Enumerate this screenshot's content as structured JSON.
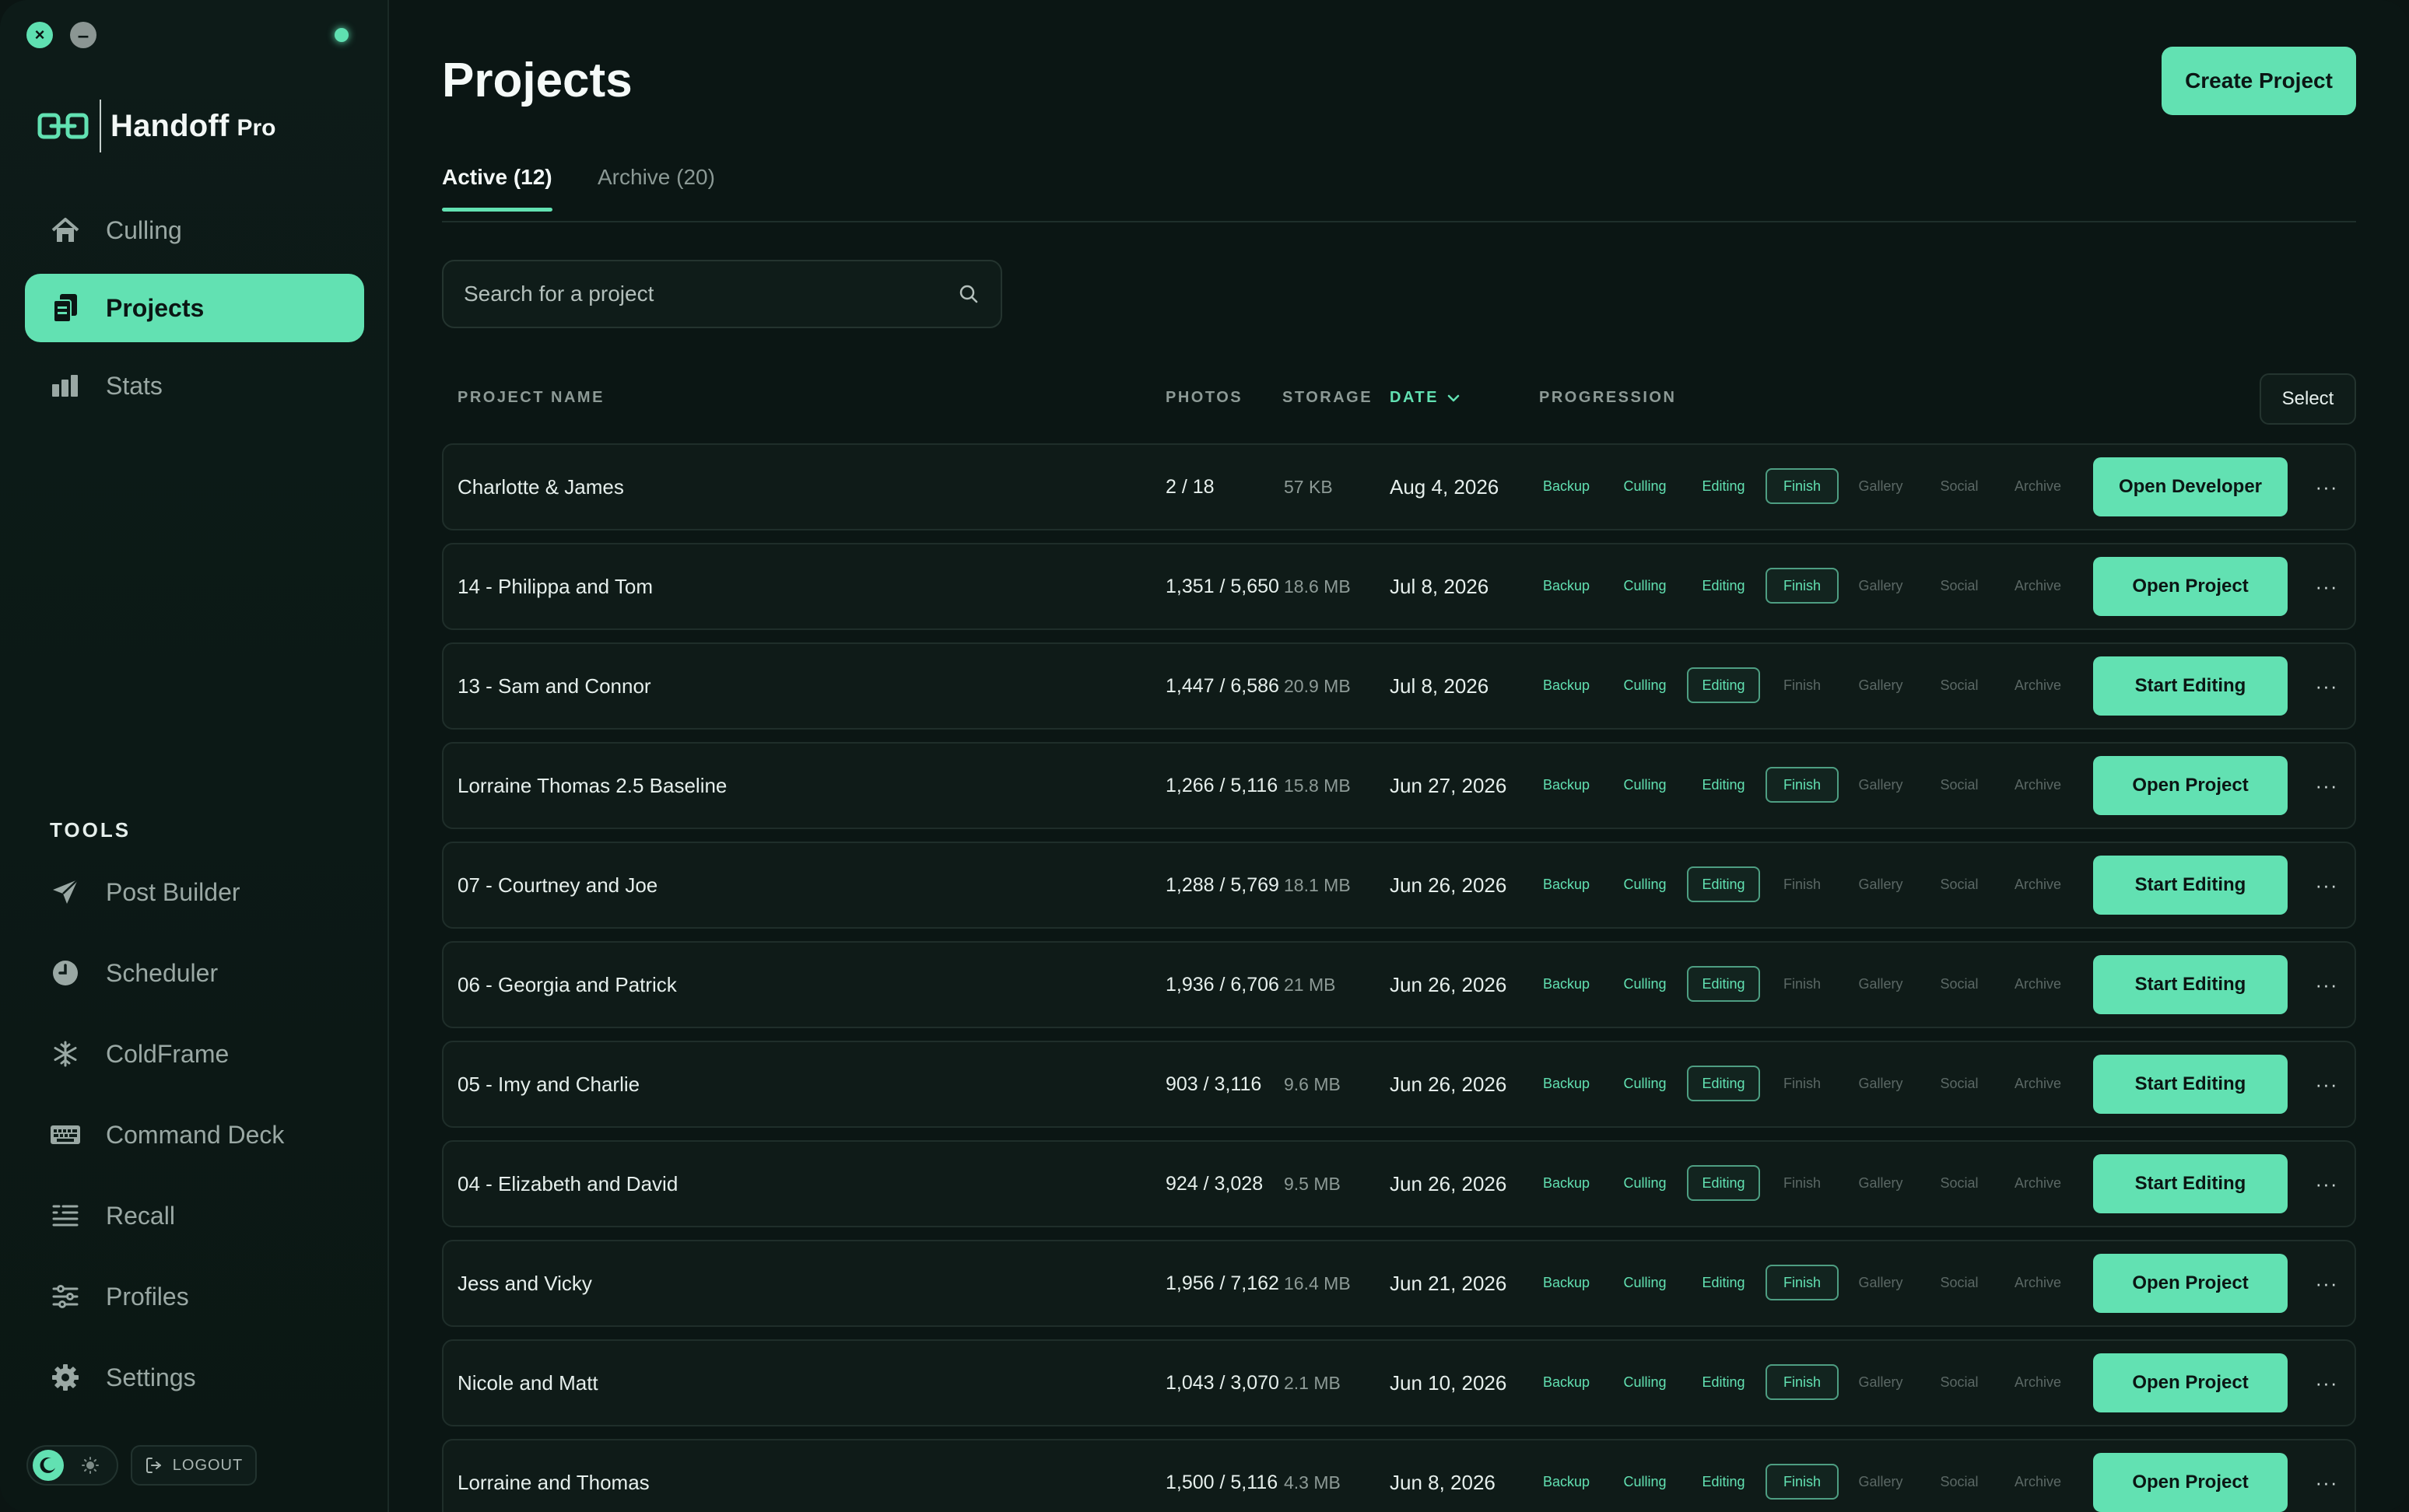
{
  "window": {
    "close_glyph": "×",
    "minimize_glyph": "–"
  },
  "brand": {
    "name": "Handoff",
    "suffix": "Pro"
  },
  "sidebar": {
    "main_items": [
      {
        "label": "Culling",
        "icon": "home-icon"
      },
      {
        "label": "Projects",
        "icon": "documents-icon",
        "active": true
      },
      {
        "label": "Stats",
        "icon": "bar-chart-icon"
      }
    ],
    "tools_heading": "TOOLS",
    "tools": [
      {
        "label": "Post Builder",
        "icon": "send-icon"
      },
      {
        "label": "Scheduler",
        "icon": "clock-icon"
      },
      {
        "label": "ColdFrame",
        "icon": "snowflake-icon"
      },
      {
        "label": "Command Deck",
        "icon": "keyboard-icon"
      },
      {
        "label": "Recall",
        "icon": "list-icon"
      },
      {
        "label": "Profiles",
        "icon": "sliders-icon"
      },
      {
        "label": "Settings",
        "icon": "gear-icon"
      }
    ],
    "logout_label": "LOGOUT"
  },
  "header": {
    "title": "Projects",
    "create_label": "Create Project",
    "tabs": [
      {
        "label": "Active (12)",
        "active": true
      },
      {
        "label": "Archive (20)",
        "active": false
      }
    ]
  },
  "search": {
    "placeholder": "Search for a project",
    "value": ""
  },
  "table": {
    "columns": {
      "name": "PROJECT NAME",
      "photos": "PHOTOS",
      "storage": "STORAGE",
      "date": "DATE",
      "progression": "PROGRESSION"
    },
    "select_label": "Select",
    "stages": [
      "Backup",
      "Culling",
      "Editing",
      "Finish",
      "Gallery",
      "Social",
      "Archive"
    ],
    "more_glyph": "···",
    "rows": [
      {
        "name": "Charlotte & James",
        "photos": "2 / 18",
        "storage": "57 KB",
        "date": "Aug 4, 2026",
        "current_stage": 3,
        "action": "Open Developer"
      },
      {
        "name": "14 - Philippa and Tom",
        "photos": "1,351 / 5,650",
        "storage": "18.6 MB",
        "date": "Jul 8, 2026",
        "current_stage": 3,
        "action": "Open Project"
      },
      {
        "name": "13 - Sam and Connor",
        "photos": "1,447 / 6,586",
        "storage": "20.9 MB",
        "date": "Jul 8, 2026",
        "current_stage": 2,
        "action": "Start Editing"
      },
      {
        "name": "Lorraine Thomas 2.5 Baseline",
        "photos": "1,266 / 5,116",
        "storage": "15.8 MB",
        "date": "Jun 27, 2026",
        "current_stage": 3,
        "action": "Open Project"
      },
      {
        "name": "07 - Courtney and Joe",
        "photos": "1,288 / 5,769",
        "storage": "18.1 MB",
        "date": "Jun 26, 2026",
        "current_stage": 2,
        "action": "Start Editing"
      },
      {
        "name": "06 - Georgia and Patrick",
        "photos": "1,936 / 6,706",
        "storage": "21 MB",
        "date": "Jun 26, 2026",
        "current_stage": 2,
        "action": "Start Editing"
      },
      {
        "name": "05 - Imy and Charlie",
        "photos": "903 / 3,116",
        "storage": "9.6 MB",
        "date": "Jun 26, 2026",
        "current_stage": 2,
        "action": "Start Editing"
      },
      {
        "name": "04 - Elizabeth and David",
        "photos": "924 / 3,028",
        "storage": "9.5 MB",
        "date": "Jun 26, 2026",
        "current_stage": 2,
        "action": "Start Editing"
      },
      {
        "name": "Jess and Vicky",
        "photos": "1,956 / 7,162",
        "storage": "16.4 MB",
        "date": "Jun 21, 2026",
        "current_stage": 3,
        "action": "Open Project"
      },
      {
        "name": "Nicole and Matt",
        "photos": "1,043 / 3,070",
        "storage": "2.1 MB",
        "date": "Jun 10, 2026",
        "current_stage": 3,
        "action": "Open Project"
      },
      {
        "name": "Lorraine and Thomas",
        "photos": "1,500 / 5,116",
        "storage": "4.3 MB",
        "date": "Jun 8, 2026",
        "current_stage": 3,
        "action": "Open Project"
      }
    ]
  },
  "colors": {
    "accent": "#62e1b2",
    "background": "#0b1614",
    "muted": "#5b6865"
  }
}
